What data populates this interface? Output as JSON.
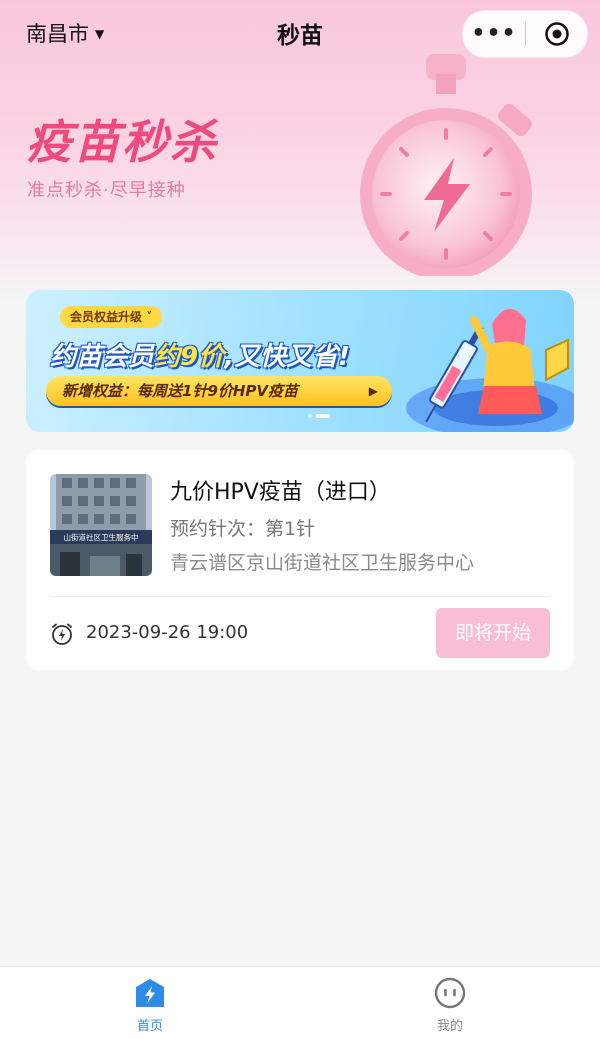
{
  "topbar": {
    "city": "南昌市",
    "title": "秒苗"
  },
  "hero": {
    "title": "疫苗秒杀",
    "subtitle": "准点秒杀·尽早接种"
  },
  "banner": {
    "tag": "会员权益升级",
    "headline_part1": "约苗会员",
    "headline_highlight": "约9价",
    "headline_part2": ",又快又省!",
    "pill": "新增权益：每周送1针9价HPV疫苗",
    "page_count": 2,
    "current_page": 2
  },
  "card": {
    "vaccine_name": "九价HPV疫苗（进口）",
    "dose": "预约针次：第1针",
    "address": "青云谱区京山街道社区卫生服务中心",
    "thumb_sign": "山街道社区卫生服务中",
    "time": "2023-09-26 19:00",
    "button": "即将开始"
  },
  "tabs": [
    {
      "label": "首页",
      "icon": "home-lightning-icon",
      "active": true
    },
    {
      "label": "我的",
      "icon": "profile-face-icon",
      "active": false
    }
  ],
  "colors": {
    "brand_pink": "#f0497d",
    "button_disabled": "#f9bed3",
    "tab_active": "#2f8be8",
    "tab_inactive": "#888888"
  }
}
